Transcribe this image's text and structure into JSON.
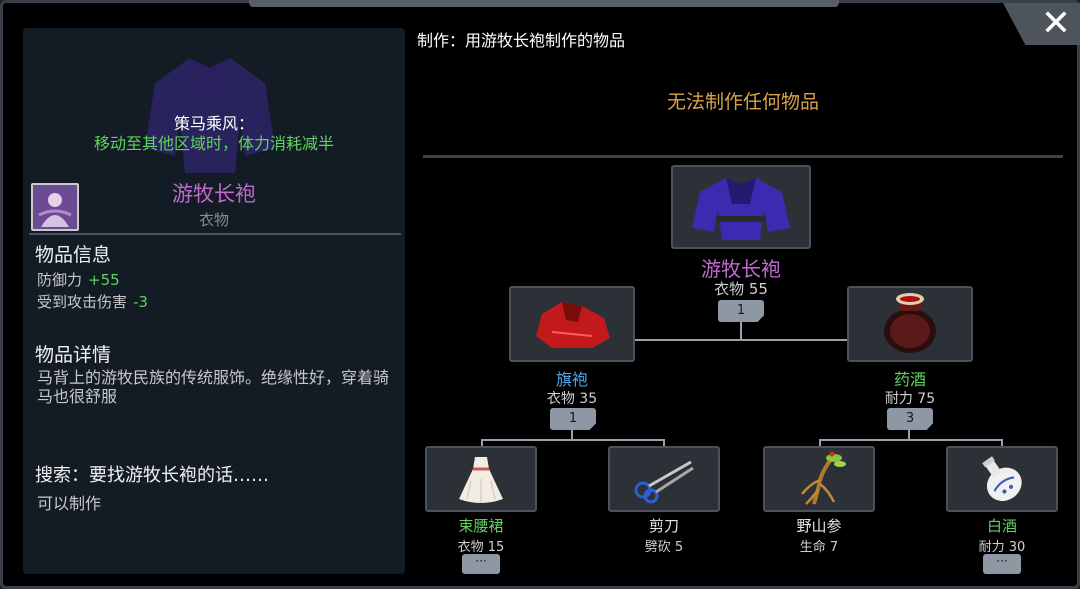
{
  "left": {
    "effect_title": "策马乘风：",
    "effect_text": "移动至其他区域时，体力消耗减半",
    "item_name": "游牧长袍",
    "item_type": "衣物",
    "info_heading": "物品信息",
    "stats": [
      {
        "label": "防御力",
        "value": "+55"
      },
      {
        "label": "受到攻击伤害",
        "value": "-3"
      }
    ],
    "detail_heading": "物品详情",
    "detail_text": "马背上的游牧民族的传统服饰。绝缘性好，穿着骑马也很舒服",
    "search_heading": "搜索：要找游牧长袍的话……",
    "search_status": "可以制作"
  },
  "right": {
    "craft_title": "制作：用游牧长袍制作的物品",
    "no_craft_text": "无法制作任何物品"
  },
  "tree": {
    "root": {
      "name": "游牧长袍",
      "sub": "衣物 55",
      "badge": "1",
      "icon": "robe-icon"
    },
    "mid_left": {
      "name": "旗袍",
      "sub": "衣物 35",
      "badge": "1",
      "icon": "red-dress-icon"
    },
    "mid_right": {
      "name": "药酒",
      "sub": "耐力 75",
      "badge": "3",
      "icon": "wine-jar-icon"
    },
    "leaf1": {
      "name": "束腰裙",
      "sub": "衣物 15",
      "more": "···",
      "icon": "skirt-icon"
    },
    "leaf2": {
      "name": "剪刀",
      "sub": "劈砍 5",
      "icon": "scissors-icon"
    },
    "leaf3": {
      "name": "野山参",
      "sub": "生命 7",
      "icon": "ginseng-icon"
    },
    "leaf4": {
      "name": "白酒",
      "sub": "耐力 30",
      "more": "···",
      "icon": "liquor-bottle-icon"
    }
  },
  "colors": {
    "purple_name": "#c06ad0",
    "blue_name": "#4fa8e6",
    "green_name": "#5fd35f",
    "gold_text": "#d8a24a"
  },
  "close_icon": "close-icon"
}
